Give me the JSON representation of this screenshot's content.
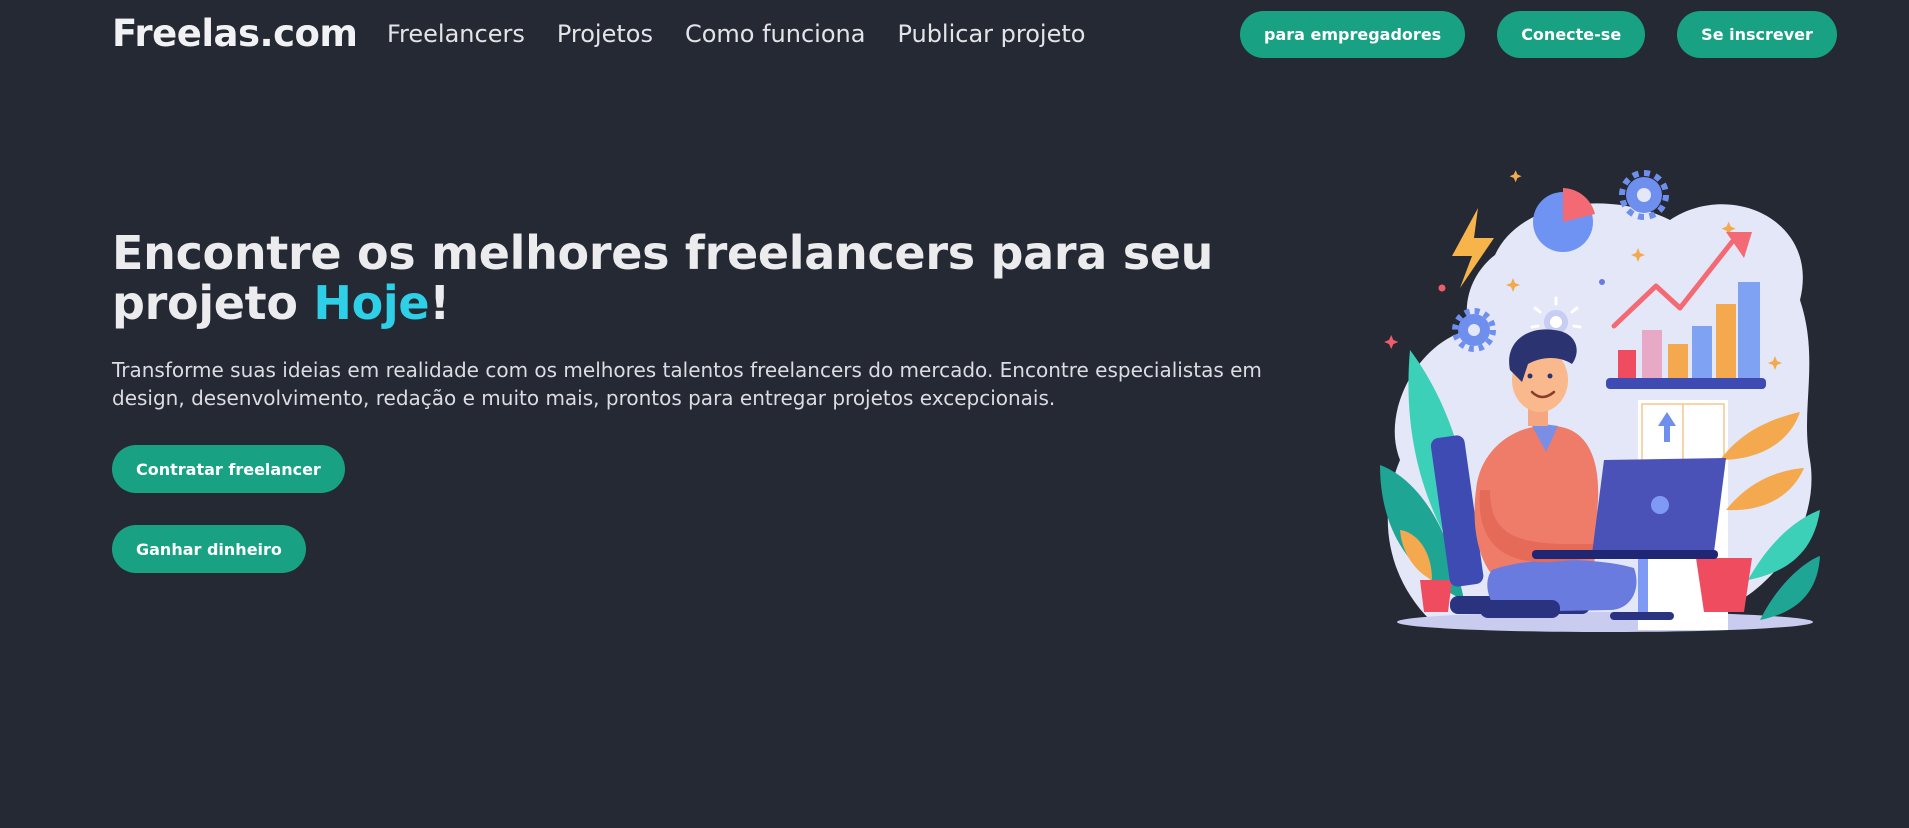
{
  "header": {
    "logo": "Freelas.com",
    "nav": [
      "Freelancers",
      "Projetos",
      "Como funciona",
      "Publicar projeto"
    ],
    "employers_button": "para empregadores",
    "login_button": "Conecte-se",
    "signup_button": "Se inscrever"
  },
  "hero": {
    "title_part1": "Encontre os melhores freelancers para seu projeto ",
    "title_highlight": "Hoje",
    "title_end": "!",
    "description": "Transforme suas ideias em realidade com os melhores talentos freelancers do mercado. Encontre especialistas em design, desenvolvimento, redação e muito mais, prontos para entregar projetos excepcionais.",
    "hire_button": "Contratar freelancer",
    "earn_button": "Ganhar dinheiro"
  },
  "colors": {
    "background": "#252933",
    "accent": "#18a283",
    "highlight": "#2ed0e8"
  }
}
